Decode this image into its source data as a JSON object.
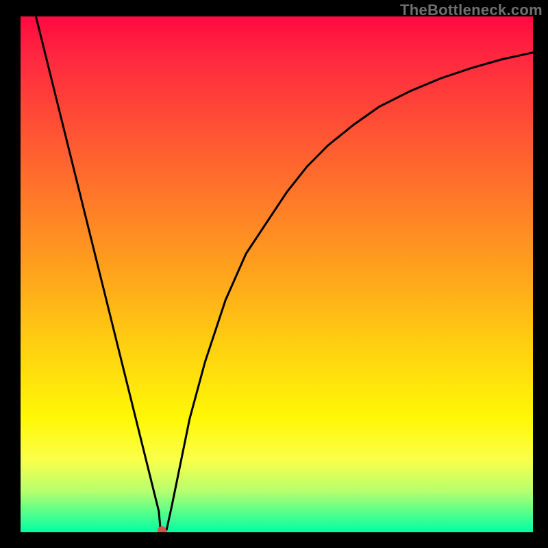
{
  "watermark": "TheBottleneck.com",
  "chart_data": {
    "type": "line",
    "title": "",
    "xlabel": "",
    "ylabel": "",
    "xlim": [
      0,
      100
    ],
    "ylim": [
      0,
      100
    ],
    "grid": false,
    "legend": false,
    "series": [
      {
        "name": "curve",
        "x": [
          3,
          6,
          9,
          12,
          15,
          18,
          21,
          24,
          26,
          27,
          27.3,
          27.6,
          28,
          28.5,
          29.5,
          33,
          36,
          40,
          44,
          48,
          52,
          56,
          60,
          65,
          70,
          76,
          82,
          88,
          94,
          100
        ],
        "y": [
          100,
          88,
          76,
          64,
          52,
          40,
          28,
          16,
          8,
          4,
          0.5,
          0.3,
          0.3,
          0.5,
          5,
          22,
          33,
          45,
          54,
          60,
          66,
          71,
          75,
          79,
          82.5,
          85.5,
          88,
          90,
          91.7,
          93
        ],
        "color": "#000000"
      }
    ],
    "marker": {
      "name": "dot",
      "x": 27.6,
      "y": 0.3,
      "color": "#d35447",
      "radius_px": 6.5
    },
    "background_gradient": {
      "direction": "top-to-bottom",
      "stops": [
        {
          "pos": 0.0,
          "color": "#ff0a41"
        },
        {
          "pos": 0.08,
          "color": "#ff2840"
        },
        {
          "pos": 0.22,
          "color": "#ff5234"
        },
        {
          "pos": 0.36,
          "color": "#ff7b28"
        },
        {
          "pos": 0.5,
          "color": "#ffa41c"
        },
        {
          "pos": 0.64,
          "color": "#ffd010"
        },
        {
          "pos": 0.78,
          "color": "#fff806"
        },
        {
          "pos": 0.86,
          "color": "#faff4a"
        },
        {
          "pos": 0.92,
          "color": "#b8ff6e"
        },
        {
          "pos": 0.96,
          "color": "#5aff8a"
        },
        {
          "pos": 1.0,
          "color": "#00ffa2"
        }
      ]
    }
  }
}
